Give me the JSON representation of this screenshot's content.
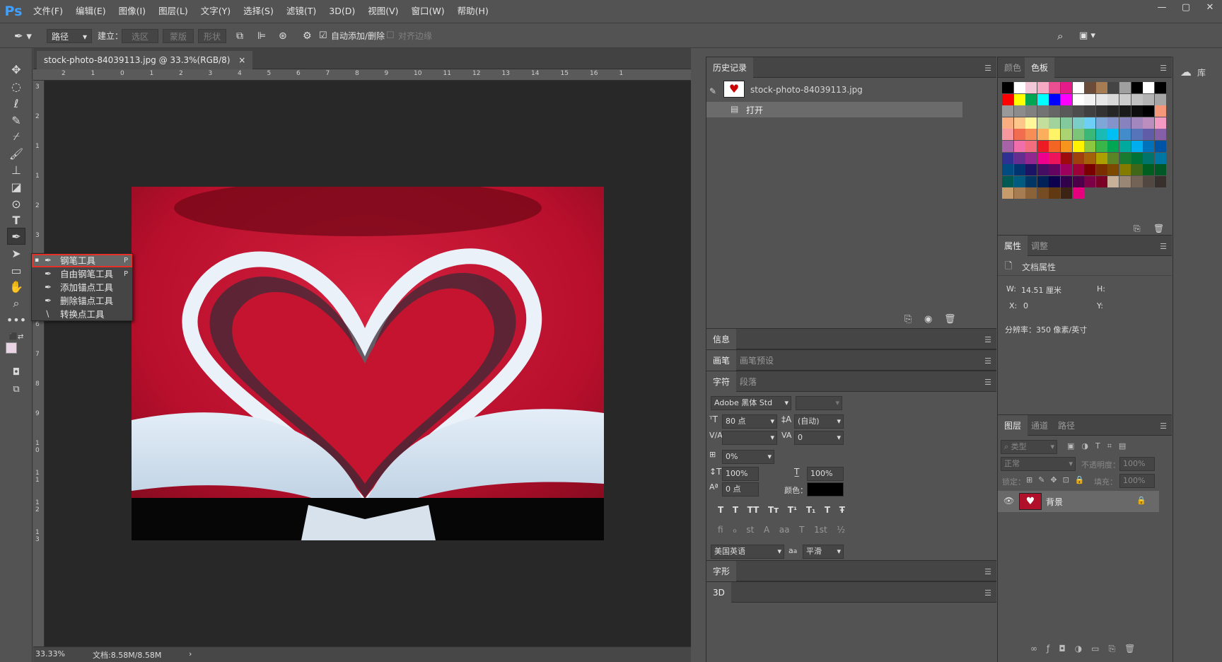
{
  "app": {
    "logo": "Ps"
  },
  "menu": [
    "文件(F)",
    "编辑(E)",
    "图像(I)",
    "图层(L)",
    "文字(Y)",
    "选择(S)",
    "滤镜(T)",
    "3D(D)",
    "视图(V)",
    "窗口(W)",
    "帮助(H)"
  ],
  "window_controls": {
    "minimize": "—",
    "restore": "▢",
    "close": "✕"
  },
  "options": {
    "mode": "路径",
    "build_label": "建立：",
    "selection_btn": "选区 ...",
    "mask_btn": "蒙版",
    "shape_btn": "形状",
    "auto_add_delete": "自动添加/删除",
    "align_edges": "对齐边缘"
  },
  "document": {
    "tab_title": "stock-photo-84039113.jpg @ 33.3%(RGB/8)",
    "tab_close": "×",
    "zoom": "33.33%",
    "doc_size": "文档:8.58M/8.58M",
    "status_arrow": "›"
  },
  "ruler_h": [
    "2",
    "1",
    "0",
    "1",
    "2",
    "3",
    "4",
    "5",
    "6",
    "7",
    "8",
    "9",
    "10",
    "11",
    "12",
    "13",
    "14",
    "15",
    "16",
    "1"
  ],
  "ruler_v": [
    "3",
    "2",
    "1",
    "1",
    "2",
    "3",
    "4",
    "5",
    "6",
    "7",
    "8",
    "9",
    "1 0",
    "1 1",
    "1 2",
    "1 3"
  ],
  "flyout": {
    "items": [
      {
        "label": "钢笔工具",
        "key": "P",
        "icon": "pen-icon"
      },
      {
        "label": "自由钢笔工具",
        "key": "P",
        "icon": "freeform-pen-icon"
      },
      {
        "label": "添加锚点工具",
        "key": "",
        "icon": "add-anchor-icon"
      },
      {
        "label": "删除锚点工具",
        "key": "",
        "icon": "delete-anchor-icon"
      },
      {
        "label": "转换点工具",
        "key": "",
        "icon": "convert-point-icon"
      }
    ]
  },
  "history": {
    "tab": "历史记录",
    "snapshot": "stock-photo-84039113.jpg",
    "step": "打开"
  },
  "info": {
    "tab": "信息"
  },
  "brush": {
    "tab1": "画笔",
    "tab2": "画笔预设"
  },
  "character": {
    "tab1": "字符",
    "tab2": "段落",
    "font_family": "Adobe 黑体 Std",
    "font_size": "80 点",
    "leading": "(自动)",
    "tracking": "0",
    "scale_percent": "0%",
    "vertical_scale": "100%",
    "horizontal_scale": "100%",
    "baseline_shift": "0 点",
    "color_label": "颜色：",
    "language": "美国英语",
    "aa_label": "a",
    "antialias": "平滑",
    "style_buttons": [
      "T",
      "T",
      "TT",
      "Tт",
      "T¹",
      "T₁",
      "T",
      "Ŧ"
    ],
    "opentype_buttons": [
      "fi",
      "ℴ",
      "st",
      "A",
      "aa",
      "T",
      "1st",
      "½"
    ]
  },
  "glyphs": {
    "tab": "字形"
  },
  "threeD": {
    "tab": "3D"
  },
  "swatches": {
    "tab1": "颜色",
    "tab2": "色板",
    "colors": [
      "#000000",
      "#ffffff",
      "#f2c8d8",
      "#f5a9c3",
      "#e94f91",
      "#e51b89",
      "#ffffff",
      "#6b4c3b",
      "#a67c52",
      "#444444",
      "#a0a0a0",
      "#000000",
      "#ffffff",
      "#000000",
      "#ff0000",
      "#ffff00",
      "#00a651",
      "#00ffff",
      "#0000ff",
      "#ff00ff",
      "#ffffff",
      "#f2f2f2",
      "#e6e6e6",
      "#d9d9d9",
      "#cccccc",
      "#c0c0c0",
      "#b3b3b3",
      "#a6a6a6",
      "#999999",
      "#8c8c8c",
      "#808080",
      "#737373",
      "#666666",
      "#595959",
      "#4d4d4d",
      "#404040",
      "#333333",
      "#262626",
      "#1a1a1a",
      "#0d0d0d",
      "#000000",
      "#f7977a",
      "#f9ad81",
      "#fdc68a",
      "#fff79a",
      "#c4df9b",
      "#a2d39c",
      "#82ca9d",
      "#7bcdc8",
      "#6ecff6",
      "#7ea7d8",
      "#8493ca",
      "#8882be",
      "#a187be",
      "#bc8dbf",
      "#f49ac2",
      "#f6989d",
      "#f26c4f",
      "#f68e55",
      "#fbaf5c",
      "#fff467",
      "#acd372",
      "#7cc576",
      "#3bb878",
      "#1abbb4",
      "#00bff3",
      "#438ccb",
      "#5574b9",
      "#605ca8",
      "#855fa8",
      "#a763a8",
      "#f06ea9",
      "#f26d7d",
      "#ed1c24",
      "#f26522",
      "#f7941d",
      "#fff200",
      "#8dc63f",
      "#39b54a",
      "#00a651",
      "#00a99d",
      "#00aeef",
      "#0072bc",
      "#0054a6",
      "#2e3192",
      "#662d91",
      "#92278f",
      "#ec008c",
      "#ed145b",
      "#9e0b0f",
      "#a0410d",
      "#a36209",
      "#aba000",
      "#598527",
      "#197b30",
      "#007236",
      "#00746b",
      "#0076a3",
      "#004b80",
      "#003471",
      "#1b1464",
      "#440e62",
      "#630460",
      "#9e005d",
      "#9e0039",
      "#790000",
      "#7b2e00",
      "#7d4900",
      "#827b00",
      "#406618",
      "#005e20",
      "#005826",
      "#005952",
      "#005b7f",
      "#003663",
      "#002157",
      "#0d004c",
      "#32004b",
      "#4b0049",
      "#7b0046",
      "#7a0026",
      "#c7b299",
      "#998675",
      "#736357",
      "#534741",
      "#37302d",
      "#c69c6d",
      "#a67c52",
      "#8c6239",
      "#754c24",
      "#603913",
      "#3c2415",
      "#e6007e"
    ]
  },
  "properties": {
    "tab1": "属性",
    "tab2": "调整",
    "title": "文档属性",
    "w_label": "W:",
    "w_value": "14.51 厘米",
    "h_label": "H:",
    "x_label": "X:",
    "x_value": "0",
    "y_label": "Y:",
    "resolution": "分辨率：350 像素/英寸"
  },
  "layers": {
    "tab1": "图层",
    "tab2": "通道",
    "tab3": "路径",
    "filter_kind": "类型",
    "blend_mode": "正常",
    "opacity_label": "不透明度：",
    "opacity": "100%",
    "lock_label": "锁定：",
    "fill_label": "填充：",
    "fill": "100%",
    "layer_name": "背景"
  },
  "library": {
    "label": "库"
  }
}
